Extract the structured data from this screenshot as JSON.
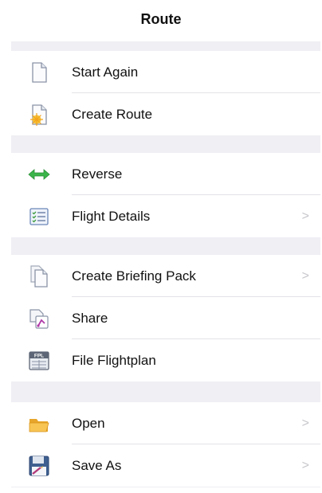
{
  "header": {
    "title": "Route"
  },
  "menu": {
    "start_again": {
      "label": "Start Again",
      "icon": "blank-document-icon"
    },
    "create_route": {
      "label": "Create Route",
      "icon": "new-document-icon"
    },
    "reverse": {
      "label": "Reverse",
      "icon": "reverse-arrows-icon"
    },
    "flight_details": {
      "label": "Flight Details",
      "icon": "checklist-icon",
      "chevron": ">"
    },
    "create_briefing_pack": {
      "label": "Create Briefing Pack",
      "icon": "documents-icon",
      "chevron": ">"
    },
    "share": {
      "label": "Share",
      "icon": "share-document-icon"
    },
    "file_flightplan": {
      "label": "File Flightplan",
      "icon": "fpl-form-icon",
      "icon_text": "FPL"
    },
    "open": {
      "label": "Open",
      "icon": "folder-icon",
      "chevron": ">"
    },
    "save_as": {
      "label": "Save As",
      "icon": "save-disk-icon",
      "chevron": ">"
    }
  }
}
